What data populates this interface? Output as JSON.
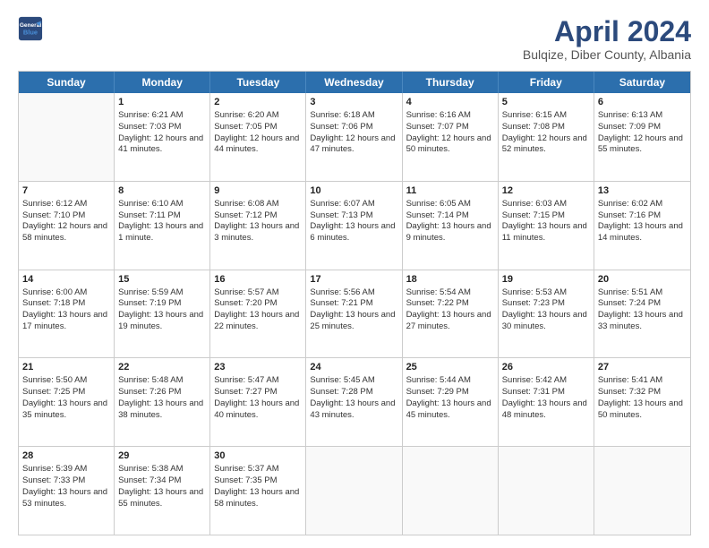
{
  "header": {
    "logo_line1": "General",
    "logo_line2": "Blue",
    "month_title": "April 2024",
    "subtitle": "Bulqize, Diber County, Albania"
  },
  "weekdays": [
    "Sunday",
    "Monday",
    "Tuesday",
    "Wednesday",
    "Thursday",
    "Friday",
    "Saturday"
  ],
  "rows": [
    [
      {
        "day": "",
        "empty": true
      },
      {
        "day": "1",
        "sunrise": "6:21 AM",
        "sunset": "7:03 PM",
        "daylight": "12 hours and 41 minutes."
      },
      {
        "day": "2",
        "sunrise": "6:20 AM",
        "sunset": "7:05 PM",
        "daylight": "12 hours and 44 minutes."
      },
      {
        "day": "3",
        "sunrise": "6:18 AM",
        "sunset": "7:06 PM",
        "daylight": "12 hours and 47 minutes."
      },
      {
        "day": "4",
        "sunrise": "6:16 AM",
        "sunset": "7:07 PM",
        "daylight": "12 hours and 50 minutes."
      },
      {
        "day": "5",
        "sunrise": "6:15 AM",
        "sunset": "7:08 PM",
        "daylight": "12 hours and 52 minutes."
      },
      {
        "day": "6",
        "sunrise": "6:13 AM",
        "sunset": "7:09 PM",
        "daylight": "12 hours and 55 minutes."
      }
    ],
    [
      {
        "day": "7",
        "sunrise": "6:12 AM",
        "sunset": "7:10 PM",
        "daylight": "12 hours and 58 minutes."
      },
      {
        "day": "8",
        "sunrise": "6:10 AM",
        "sunset": "7:11 PM",
        "daylight": "13 hours and 1 minute."
      },
      {
        "day": "9",
        "sunrise": "6:08 AM",
        "sunset": "7:12 PM",
        "daylight": "13 hours and 3 minutes."
      },
      {
        "day": "10",
        "sunrise": "6:07 AM",
        "sunset": "7:13 PM",
        "daylight": "13 hours and 6 minutes."
      },
      {
        "day": "11",
        "sunrise": "6:05 AM",
        "sunset": "7:14 PM",
        "daylight": "13 hours and 9 minutes."
      },
      {
        "day": "12",
        "sunrise": "6:03 AM",
        "sunset": "7:15 PM",
        "daylight": "13 hours and 11 minutes."
      },
      {
        "day": "13",
        "sunrise": "6:02 AM",
        "sunset": "7:16 PM",
        "daylight": "13 hours and 14 minutes."
      }
    ],
    [
      {
        "day": "14",
        "sunrise": "6:00 AM",
        "sunset": "7:18 PM",
        "daylight": "13 hours and 17 minutes."
      },
      {
        "day": "15",
        "sunrise": "5:59 AM",
        "sunset": "7:19 PM",
        "daylight": "13 hours and 19 minutes."
      },
      {
        "day": "16",
        "sunrise": "5:57 AM",
        "sunset": "7:20 PM",
        "daylight": "13 hours and 22 minutes."
      },
      {
        "day": "17",
        "sunrise": "5:56 AM",
        "sunset": "7:21 PM",
        "daylight": "13 hours and 25 minutes."
      },
      {
        "day": "18",
        "sunrise": "5:54 AM",
        "sunset": "7:22 PM",
        "daylight": "13 hours and 27 minutes."
      },
      {
        "day": "19",
        "sunrise": "5:53 AM",
        "sunset": "7:23 PM",
        "daylight": "13 hours and 30 minutes."
      },
      {
        "day": "20",
        "sunrise": "5:51 AM",
        "sunset": "7:24 PM",
        "daylight": "13 hours and 33 minutes."
      }
    ],
    [
      {
        "day": "21",
        "sunrise": "5:50 AM",
        "sunset": "7:25 PM",
        "daylight": "13 hours and 35 minutes."
      },
      {
        "day": "22",
        "sunrise": "5:48 AM",
        "sunset": "7:26 PM",
        "daylight": "13 hours and 38 minutes."
      },
      {
        "day": "23",
        "sunrise": "5:47 AM",
        "sunset": "7:27 PM",
        "daylight": "13 hours and 40 minutes."
      },
      {
        "day": "24",
        "sunrise": "5:45 AM",
        "sunset": "7:28 PM",
        "daylight": "13 hours and 43 minutes."
      },
      {
        "day": "25",
        "sunrise": "5:44 AM",
        "sunset": "7:29 PM",
        "daylight": "13 hours and 45 minutes."
      },
      {
        "day": "26",
        "sunrise": "5:42 AM",
        "sunset": "7:31 PM",
        "daylight": "13 hours and 48 minutes."
      },
      {
        "day": "27",
        "sunrise": "5:41 AM",
        "sunset": "7:32 PM",
        "daylight": "13 hours and 50 minutes."
      }
    ],
    [
      {
        "day": "28",
        "sunrise": "5:39 AM",
        "sunset": "7:33 PM",
        "daylight": "13 hours and 53 minutes."
      },
      {
        "day": "29",
        "sunrise": "5:38 AM",
        "sunset": "7:34 PM",
        "daylight": "13 hours and 55 minutes."
      },
      {
        "day": "30",
        "sunrise": "5:37 AM",
        "sunset": "7:35 PM",
        "daylight": "13 hours and 58 minutes."
      },
      {
        "day": "",
        "empty": true
      },
      {
        "day": "",
        "empty": true
      },
      {
        "day": "",
        "empty": true
      },
      {
        "day": "",
        "empty": true
      }
    ]
  ],
  "labels": {
    "sunrise_prefix": "Sunrise: ",
    "sunset_prefix": "Sunset: ",
    "daylight_prefix": "Daylight: "
  }
}
